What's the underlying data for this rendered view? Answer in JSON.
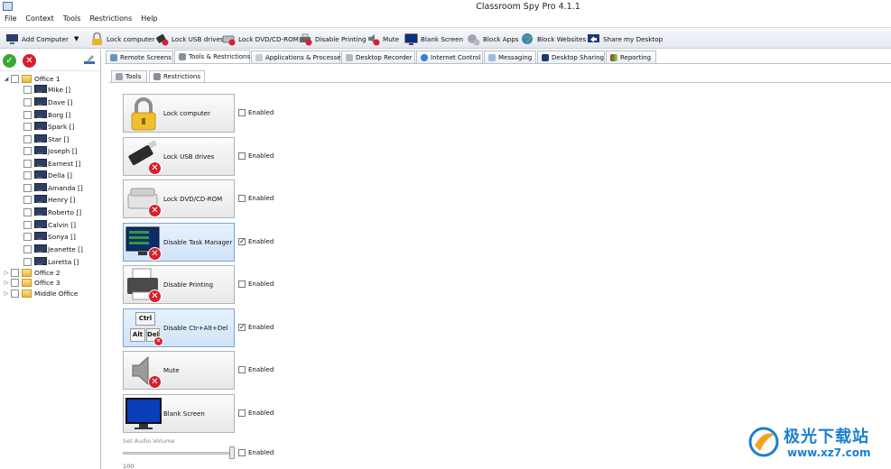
{
  "window": {
    "title": "Classroom Spy Pro 4.1.1"
  },
  "menu": [
    "File",
    "Context",
    "Tools",
    "Restrictions",
    "Help"
  ],
  "toolbar": {
    "add_computer": "Add Computer",
    "lock_computer": "Lock computer",
    "lock_usb": "Lock USB drives",
    "lock_dvd": "Lock DVD/CD-ROM",
    "disable_printing": "Disable Printing",
    "mute": "Mute",
    "blank_screen": "Blank Screen",
    "block_apps": "Block Apps",
    "block_websites": "Block Websites",
    "share_desktop": "Share my Desktop"
  },
  "tree": {
    "groups": [
      {
        "label": "Office 1",
        "expanded": true,
        "computers": [
          "Mike []",
          "Dave []",
          "Borg []",
          "Spark []",
          "Star []",
          "Joseph []",
          "Earnest []",
          "Della []",
          "Amanda []",
          "Henry []",
          "Roberto []",
          "Calvin []",
          "Sonya []",
          "Jeanette []",
          "Loretta []"
        ]
      },
      {
        "label": "Office 2",
        "expanded": false
      },
      {
        "label": "Office 3",
        "expanded": false
      },
      {
        "label": "Middle Office",
        "expanded": false
      }
    ]
  },
  "main_tabs": [
    "Remote Screens",
    "Tools & Restrictions",
    "Applications & Processes",
    "Desktop Recorder",
    "Internet Control",
    "Messaging",
    "Desktop Sharing",
    "Reporting"
  ],
  "sub_tabs": [
    "Tools",
    "Restrictions"
  ],
  "restrictions": [
    {
      "label": "Lock computer",
      "enabled": false,
      "enabled_label": "Enabled"
    },
    {
      "label": "Lock USB drives",
      "enabled": false,
      "enabled_label": "Enabled"
    },
    {
      "label": "Lock DVD/CD-ROM",
      "enabled": false,
      "enabled_label": "Enabled"
    },
    {
      "label": "Disable Task Manager",
      "enabled": true,
      "enabled_label": "Enabled"
    },
    {
      "label": "Disable Printing",
      "enabled": false,
      "enabled_label": "Enabled"
    },
    {
      "label": "Disable Ctr+Alt+Del",
      "enabled": true,
      "enabled_label": "Enabled"
    },
    {
      "label": "Mute",
      "enabled": false,
      "enabled_label": "Enabled"
    },
    {
      "label": "Blank Screen",
      "enabled": false,
      "enabled_label": "Enabled"
    }
  ],
  "audio": {
    "label": "Set Audio Volume",
    "value": "100",
    "enabled": false,
    "enabled_label": "Enabled"
  },
  "keys": {
    "ctrl": "Ctrl",
    "alt": "Alt",
    "del": "Del"
  },
  "watermark": {
    "name": "极光下载站",
    "url": "www.xz7.com"
  },
  "colors": {
    "accent": "#1b7fd1",
    "danger": "#d6202d",
    "selected": "#cfe3f8"
  }
}
